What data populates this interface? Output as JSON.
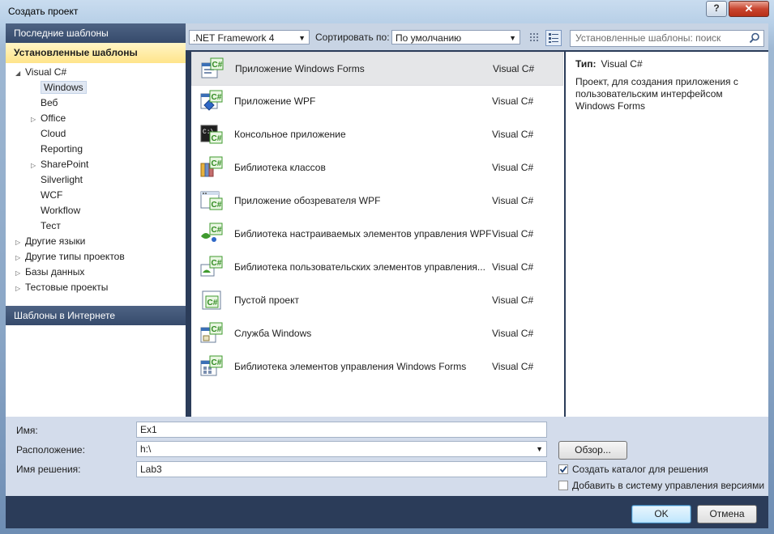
{
  "window": {
    "title": "Создать проект",
    "help_glyph": "?",
    "close_glyph": "✕"
  },
  "sidebar": {
    "recent_templates": "Последние шаблоны",
    "installed_templates": "Установленные шаблоны",
    "online_templates": "Шаблоны в Интернете",
    "tree": [
      {
        "label": "Visual C#",
        "arrow": "◢",
        "level": 0
      },
      {
        "label": "Windows",
        "arrow": "",
        "level": 1,
        "selected": true
      },
      {
        "label": "Веб",
        "arrow": "",
        "level": 1
      },
      {
        "label": "Office",
        "arrow": "▷",
        "level": 1
      },
      {
        "label": "Cloud",
        "arrow": "",
        "level": 1
      },
      {
        "label": "Reporting",
        "arrow": "",
        "level": 1
      },
      {
        "label": "SharePoint",
        "arrow": "▷",
        "level": 1
      },
      {
        "label": "Silverlight",
        "arrow": "",
        "level": 1
      },
      {
        "label": "WCF",
        "arrow": "",
        "level": 1
      },
      {
        "label": "Workflow",
        "arrow": "",
        "level": 1
      },
      {
        "label": "Тест",
        "arrow": "",
        "level": 1
      },
      {
        "label": "Другие языки",
        "arrow": "▷",
        "level": 0
      },
      {
        "label": "Другие типы проектов",
        "arrow": "▷",
        "level": 0
      },
      {
        "label": "Базы данных",
        "arrow": "▷",
        "level": 0
      },
      {
        "label": "Тестовые проекты",
        "arrow": "▷",
        "level": 0
      }
    ]
  },
  "toolbar": {
    "framework": ".NET Framework 4",
    "sort_label": "Сортировать по:",
    "sort_value": "По умолчанию",
    "search_placeholder": "Установленные шаблоны: поиск"
  },
  "templates": [
    {
      "name": "Приложение Windows Forms",
      "lang": "Visual C#",
      "icon": "winforms-icon",
      "selected": true
    },
    {
      "name": "Приложение WPF",
      "lang": "Visual C#",
      "icon": "wpf-icon"
    },
    {
      "name": "Консольное приложение",
      "lang": "Visual C#",
      "icon": "console-icon"
    },
    {
      "name": "Библиотека классов",
      "lang": "Visual C#",
      "icon": "class-library-icon"
    },
    {
      "name": "Приложение обозревателя WPF",
      "lang": "Visual C#",
      "icon": "wpf-browser-icon"
    },
    {
      "name": "Библиотека настраиваемых элементов управления WPF",
      "lang": "Visual C#",
      "icon": "wpf-custom-control-icon"
    },
    {
      "name": "Библиотека пользовательских элементов управления...",
      "lang": "Visual C#",
      "icon": "wpf-user-control-icon"
    },
    {
      "name": "Пустой проект",
      "lang": "Visual C#",
      "icon": "empty-project-icon"
    },
    {
      "name": "Служба Windows",
      "lang": "Visual C#",
      "icon": "windows-service-icon"
    },
    {
      "name": "Библиотека элементов управления Windows Forms",
      "lang": "Visual C#",
      "icon": "winforms-control-library-icon"
    }
  ],
  "details": {
    "type_label": "Тип:",
    "type_value": "Visual C#",
    "description": "Проект, для создания приложения с пользовательским интерфейсом Windows Forms"
  },
  "form": {
    "name_label": "Имя:",
    "name_value": "Ex1",
    "location_label": "Расположение:",
    "location_value": "h:\\",
    "solution_label": "Имя решения:",
    "solution_value": "Lab3",
    "browse_label": "Обзор...",
    "create_dir_label": "Создать каталог для решения",
    "create_dir_checked": true,
    "add_vcs_label": "Добавить в систему управления версиями",
    "add_vcs_checked": false
  },
  "buttons": {
    "ok": "OK",
    "cancel": "Отмена"
  },
  "colors": {
    "csharp_green": "#3f9a2e",
    "header_blue": "#364a6b",
    "active_yellow": "#ffe48a"
  }
}
